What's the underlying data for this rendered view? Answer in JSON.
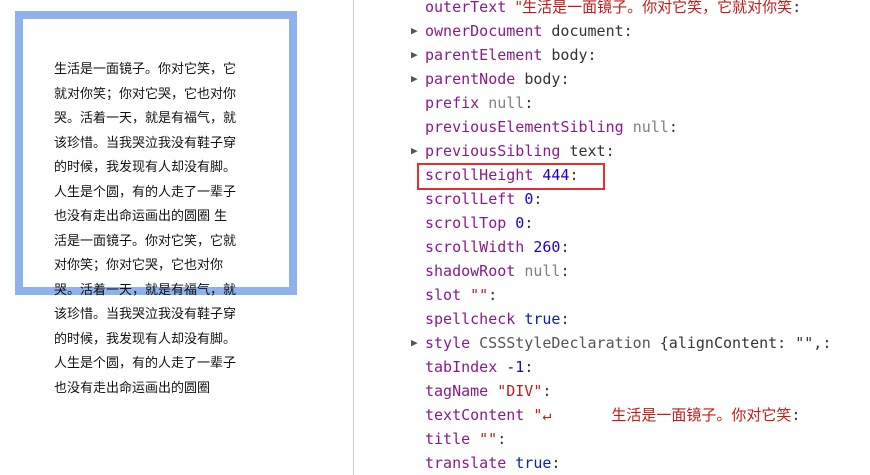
{
  "demo": {
    "lines": [
      "生活是一面镜子。你对它笑，它",
      "就对你笑；你对它哭，它也对你",
      "哭。活着一天，就是有福气，就",
      "该珍惜。当我哭泣我没有鞋子穿",
      "的时候，我发现有人却没有脚。",
      "人生是个圆，有的人走了一辈子",
      "也没有走出命运画出的圆圈 生",
      "活是一面镜子。你对它笑，它就",
      "对你笑；你对它哭，它也对你",
      "哭。活着一天，就是有福气，就",
      "该珍惜。当我哭泣我没有鞋子穿",
      "的时候，我发现有人却没有脚。",
      "人生是个圆，有的人走了一辈子",
      "也没有走出命运画出的圆圈"
    ]
  },
  "properties": [
    {
      "name": "outerText",
      "value": "\"生活是一面镜子。你对它笑，它就对你笑",
      "type": "string",
      "expandable": false
    },
    {
      "name": "ownerDocument",
      "value": "document",
      "type": "ident",
      "expandable": true
    },
    {
      "name": "parentElement",
      "value": "body",
      "type": "ident",
      "expandable": true
    },
    {
      "name": "parentNode",
      "value": "body",
      "type": "ident",
      "expandable": true
    },
    {
      "name": "prefix",
      "value": "null",
      "type": "null",
      "expandable": false
    },
    {
      "name": "previousElementSibling",
      "value": "null",
      "type": "null",
      "expandable": false
    },
    {
      "name": "previousSibling",
      "value": "text",
      "type": "ident",
      "expandable": true
    },
    {
      "name": "scrollHeight",
      "value": "444",
      "type": "number",
      "expandable": false
    },
    {
      "name": "scrollLeft",
      "value": "0",
      "type": "number",
      "expandable": false
    },
    {
      "name": "scrollTop",
      "value": "0",
      "type": "number",
      "expandable": false
    },
    {
      "name": "scrollWidth",
      "value": "260",
      "type": "number",
      "expandable": false
    },
    {
      "name": "shadowRoot",
      "value": "null",
      "type": "null",
      "expandable": false
    },
    {
      "name": "slot",
      "value": "\"\"",
      "type": "string",
      "expandable": false
    },
    {
      "name": "spellcheck",
      "value": "true",
      "type": "bool",
      "expandable": false
    },
    {
      "name": "style",
      "value_class": "CSSStyleDeclaration",
      "value": "{alignContent: \"\",",
      "type": "obj",
      "expandable": true
    },
    {
      "name": "tabIndex",
      "value": "-1",
      "type": "number",
      "expandable": false
    },
    {
      "name": "tagName",
      "value": "\"DIV\"",
      "type": "string",
      "expandable": false
    },
    {
      "name": "textContent",
      "value": "\"↵",
      "value_extra": "生活是一面镜子。你对它笑",
      "type": "string",
      "expandable": false
    },
    {
      "name": "title",
      "value": "\"\"",
      "type": "string",
      "expandable": false
    },
    {
      "name": "translate",
      "value": "true",
      "type": "bool",
      "expandable": false
    }
  ],
  "highlight": {
    "property": "scrollHeight",
    "color": "#e03030"
  },
  "colors": {
    "box_border": "#8fb1ee",
    "prop_name": "#8a1a8a",
    "string": "#c41a16",
    "number": "#1c00cf",
    "null": "#808080"
  },
  "icons": {
    "expand": "triangle-right-icon"
  }
}
